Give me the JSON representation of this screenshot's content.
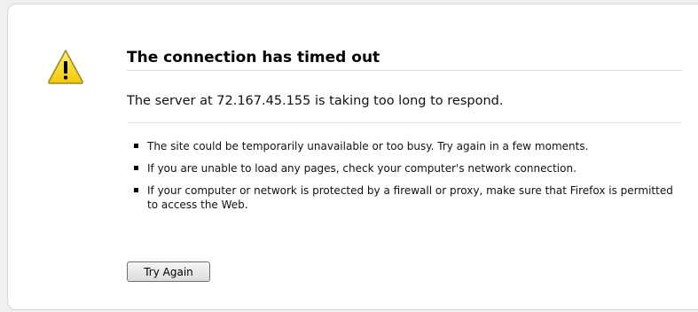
{
  "error": {
    "title": "The connection has timed out",
    "short_description": "The server at 72.167.45.155 is taking too long to respond.",
    "suggestions": [
      "The site could be temporarily unavailable or too busy. Try again in a few moments.",
      "If you are unable to load any pages, check your computer's network connection.",
      "If your computer or network is protected by a firewall or proxy, make sure that Firefox is permitted to access the Web."
    ],
    "try_again_label": "Try Again",
    "icon": "warning-triangle-icon",
    "icon_colors": {
      "fill": "#f5d400",
      "stroke": "#9a8a2a",
      "glyph": "#000000"
    }
  }
}
